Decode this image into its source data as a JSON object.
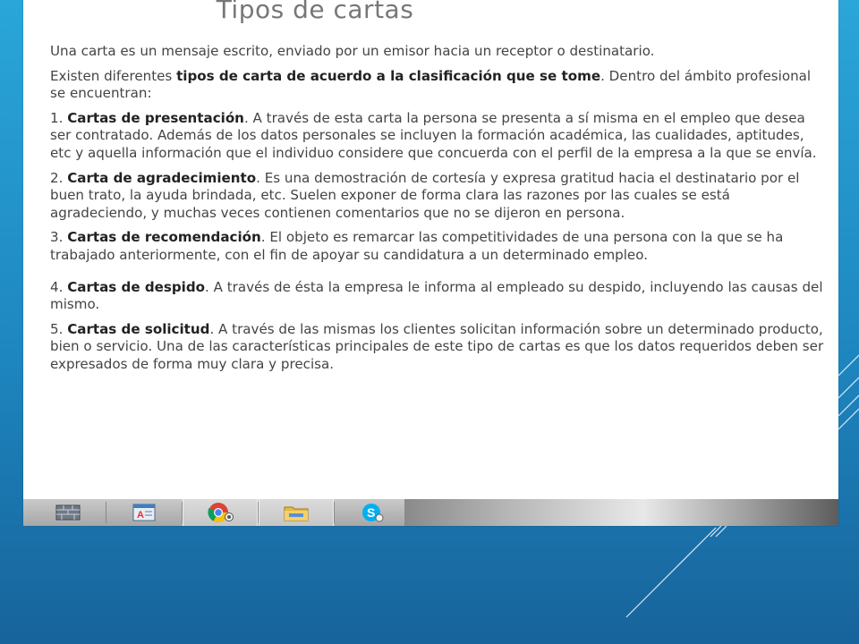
{
  "document": {
    "title": "Tipos de cartas",
    "intro": "Una carta es un mensaje escrito, enviado por un emisor hacia un receptor o destinatario.",
    "types_pre": "Existen diferentes ",
    "types_bold": "tipos de carta de acuerdo a la clasificación que se tome",
    "types_post": ". Dentro del ámbito profesional se encuentran:",
    "items": [
      {
        "number": "1. ",
        "title": "Cartas de presentación",
        "text": ". A través de esta carta la persona se presenta a sí misma en el empleo que desea ser contratado. Además de los datos personales se incluyen  la formación académica, las cualidades, aptitudes, etc y aquella información  que el individuo considere que concuerda con el perfil de la empresa a la que se envía."
      },
      {
        "number": "2. ",
        "title": "Carta de agradecimiento",
        "text": ". Es una demostración de cortesía y expresa gratitud hacia el destinatario por el buen trato, la ayuda brindada, etc. Suelen exponer de forma clara las razones por las cuales se está agradeciendo, y muchas veces contienen comentarios que no se dijeron en persona."
      },
      {
        "number": "3. ",
        "title": "Cartas de recomendación",
        "text": ". El objeto es remarcar las competitividades de una persona con la que se ha trabajado anteriormente, con el fin de apoyar su candidatura a un determinado empleo."
      },
      {
        "number": "4. ",
        "title": "Cartas de despido",
        "text": ". A través de ésta la empresa le informa al empleado su despido, incluyendo las causas del mismo."
      },
      {
        "number": "5. ",
        "title": "Cartas de solicitud",
        "text": ". A través de las mismas los clientes solicitan información sobre un determinado producto, bien o servicio. Una de las características principales de este tipo de cartas es que los datos requeridos deben ser expresados de forma muy clara y precisa."
      }
    ]
  },
  "taskbar": {
    "apps": [
      {
        "name": "bricks-app-icon"
      },
      {
        "name": "mail-app-icon"
      },
      {
        "name": "chrome-icon"
      },
      {
        "name": "file-explorer-icon"
      },
      {
        "name": "skype-icon"
      }
    ]
  },
  "colors": {
    "background_top": "#2aa6d8",
    "background_bottom": "#17639b",
    "title": "#777777",
    "text": "#444444"
  }
}
